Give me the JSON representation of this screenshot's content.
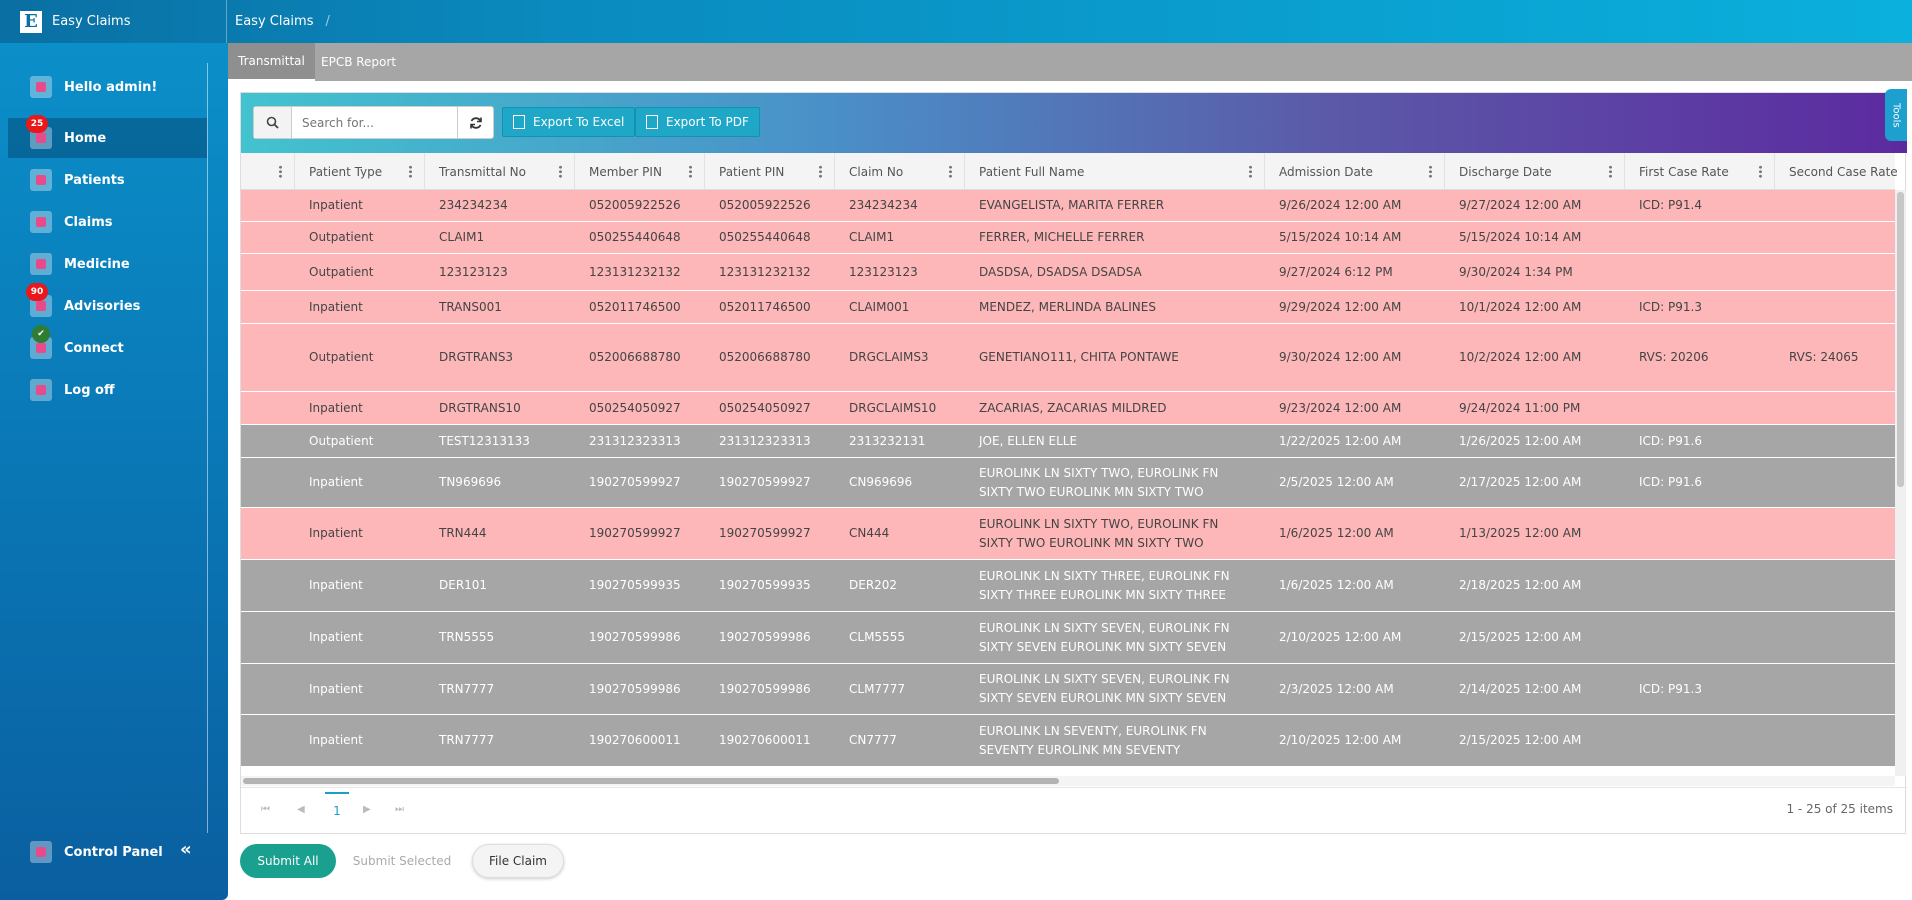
{
  "app": {
    "title": "Easy Claims",
    "logo_letter": "E"
  },
  "breadcrumb": {
    "current": "Easy Claims",
    "separator": "/"
  },
  "sidebar": {
    "greeting": "Hello admin!",
    "items": [
      {
        "label": "Home",
        "badge": "25",
        "active": true,
        "icon": "home-icon"
      },
      {
        "label": "Patients",
        "icon": "patients-icon"
      },
      {
        "label": "Claims",
        "icon": "claims-icon"
      },
      {
        "label": "Medicine",
        "icon": "medicine-icon"
      },
      {
        "label": "Advisories",
        "badge": "90",
        "icon": "advisories-icon"
      },
      {
        "label": "Connect",
        "badge": "✔",
        "icon": "connect-icon"
      },
      {
        "label": "Log off",
        "icon": "power-icon"
      }
    ],
    "control_panel": "Control Panel",
    "collapse": "«"
  },
  "tabs": [
    {
      "label": "Transmittal",
      "active": true
    },
    {
      "label": "EPCB Report"
    }
  ],
  "toolbar": {
    "search_placeholder": "Search for...",
    "export_excel": "Export To Excel",
    "export_pdf": "Export To PDF",
    "tools": "Tools"
  },
  "table": {
    "columns": [
      "Patient Type",
      "Transmittal No",
      "Member PIN",
      "Patient PIN",
      "Claim No",
      "Patient Full Name",
      "Admission Date",
      "Discharge Date",
      "First Case Rate",
      "Second Case Rate"
    ],
    "rows": [
      {
        "style": "pink",
        "cells": [
          "Inpatient",
          "234234234",
          "052005922526",
          "052005922526",
          "234234234",
          "EVANGELISTA, MARITA FERRER",
          "9/26/2024 12:00 AM",
          "9/27/2024 12:00 AM",
          "ICD: P91.4",
          ""
        ]
      },
      {
        "style": "pink",
        "cells": [
          "Outpatient",
          "CLAIM1",
          "050255440648",
          "050255440648",
          "CLAIM1",
          "FERRER, MICHELLE FERRER",
          "5/15/2024 10:14 AM",
          "5/15/2024 10:14 AM",
          "",
          ""
        ]
      },
      {
        "style": "pink",
        "cells": [
          "Outpatient",
          "123123123",
          "123131232132",
          "123131232132",
          "123123123",
          "DASDSA, DSADSA DSADSA",
          "9/27/2024 6:12 PM",
          "9/30/2024 1:34 PM",
          "",
          ""
        ]
      },
      {
        "style": "pink",
        "cells": [
          "Inpatient",
          "TRANS001",
          "052011746500",
          "052011746500",
          "CLAIM001",
          "MENDEZ, MERLINDA BALINES",
          "9/29/2024 12:00 AM",
          "10/1/2024 12:00 AM",
          "ICD: P91.3",
          ""
        ]
      },
      {
        "style": "pink",
        "cells": [
          "Outpatient",
          "DRGTRANS3",
          "052006688780",
          "052006688780",
          "DRGCLAIMS3",
          "GENETIANO111, CHITA PONTAWE",
          "9/30/2024 12:00 AM",
          "10/2/2024 12:00 AM",
          "RVS: 20206",
          "RVS: 24065"
        ]
      },
      {
        "style": "pink",
        "cells": [
          "Inpatient",
          "DRGTRANS10",
          "050254050927",
          "050254050927",
          "DRGCLAIMS10",
          "ZACARIAS, ZACARIAS MILDRED",
          "9/23/2024 12:00 AM",
          "9/24/2024 11:00 PM",
          "",
          ""
        ]
      },
      {
        "style": "gray",
        "cells": [
          "Outpatient",
          "TEST12313133",
          "231312323313",
          "231312323313",
          "2313232131",
          "JOE, ELLEN ELLE",
          "1/22/2025 12:00 AM",
          "1/26/2025 12:00 AM",
          "ICD: P91.6",
          ""
        ]
      },
      {
        "style": "gray",
        "cells": [
          "Inpatient",
          "TN969696",
          "190270599927",
          "190270599927",
          "CN969696",
          "EUROLINK LN SIXTY TWO, EUROLINK FN SIXTY TWO EUROLINK MN SIXTY TWO",
          "2/5/2025 12:00 AM",
          "2/17/2025 12:00 AM",
          "ICD: P91.6",
          ""
        ]
      },
      {
        "style": "pink",
        "cells": [
          "Inpatient",
          "TRN444",
          "190270599927",
          "190270599927",
          "CN444",
          "EUROLINK LN SIXTY TWO, EUROLINK FN SIXTY TWO EUROLINK MN SIXTY TWO",
          "1/6/2025 12:00 AM",
          "1/13/2025 12:00 AM",
          "",
          ""
        ]
      },
      {
        "style": "gray",
        "cells": [
          "Inpatient",
          "DER101",
          "190270599935",
          "190270599935",
          "DER202",
          "EUROLINK LN SIXTY THREE, EUROLINK FN SIXTY THREE EUROLINK MN SIXTY THREE",
          "1/6/2025 12:00 AM",
          "2/18/2025 12:00 AM",
          "",
          ""
        ]
      },
      {
        "style": "gray",
        "cells": [
          "Inpatient",
          "TRN5555",
          "190270599986",
          "190270599986",
          "CLM5555",
          "EUROLINK LN SIXTY SEVEN, EUROLINK FN SIXTY SEVEN EUROLINK MN SIXTY SEVEN",
          "2/10/2025 12:00 AM",
          "2/15/2025 12:00 AM",
          "",
          ""
        ]
      },
      {
        "style": "gray",
        "cells": [
          "Inpatient",
          "TRN7777",
          "190270599986",
          "190270599986",
          "CLM7777",
          "EUROLINK LN SIXTY SEVEN, EUROLINK FN SIXTY SEVEN EUROLINK MN SIXTY SEVEN",
          "2/3/2025 12:00 AM",
          "2/14/2025 12:00 AM",
          "ICD: P91.3",
          ""
        ]
      },
      {
        "style": "gray",
        "cells": [
          "Inpatient",
          "TRN7777",
          "190270600011",
          "190270600011",
          "CN7777",
          "EUROLINK LN SEVENTY, EUROLINK FN SEVENTY EUROLINK MN SEVENTY",
          "2/10/2025 12:00 AM",
          "2/15/2025 12:00 AM",
          "",
          ""
        ]
      }
    ]
  },
  "pager": {
    "first": "⏮",
    "prev": "◀",
    "page": "1",
    "next": "▶",
    "last": "⏭",
    "info": "1 - 25 of 25 items"
  },
  "actions": {
    "submit_all": "Submit All",
    "submit_selected": "Submit Selected",
    "file_claim": "File Claim"
  },
  "colors": {
    "pink_row": "#fdb7b9",
    "gray_row": "#a6a6a6",
    "accent": "#1aa0c8",
    "submit": "#1aa08f"
  }
}
